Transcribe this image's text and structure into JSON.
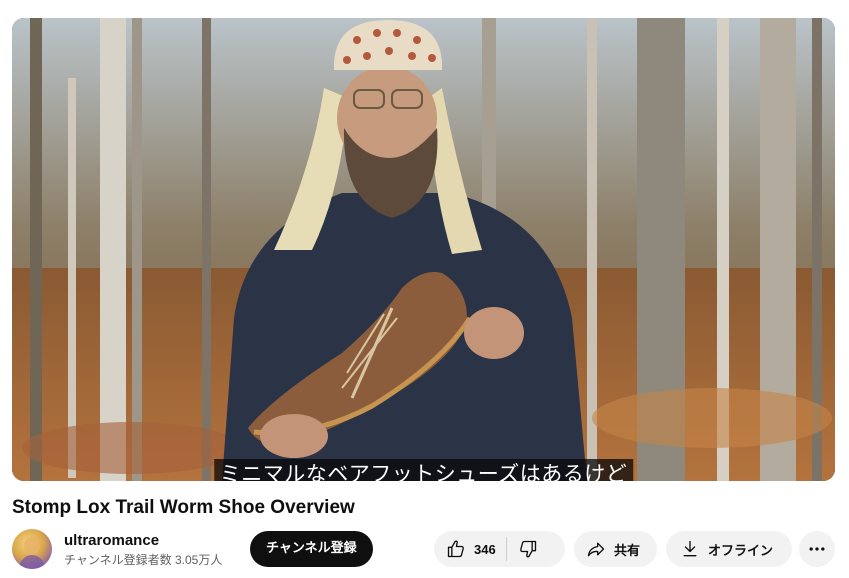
{
  "video": {
    "caption": "ミニマルなベアフットシューズはあるけど",
    "title": "Stomp Lox Trail Worm Shoe Overview"
  },
  "channel": {
    "name": "ultraromance",
    "subscribers": "チャンネル登録者数 3.05万人",
    "subscribe_label": "チャンネル登録"
  },
  "actions": {
    "like_count": "346",
    "share_label": "共有",
    "offline_label": "オフライン"
  },
  "icons": {
    "like": "thumbs-up-icon",
    "dislike": "thumbs-down-icon",
    "share": "share-arrow-icon",
    "offline": "download-icon",
    "more": "more-horizontal-icon"
  }
}
